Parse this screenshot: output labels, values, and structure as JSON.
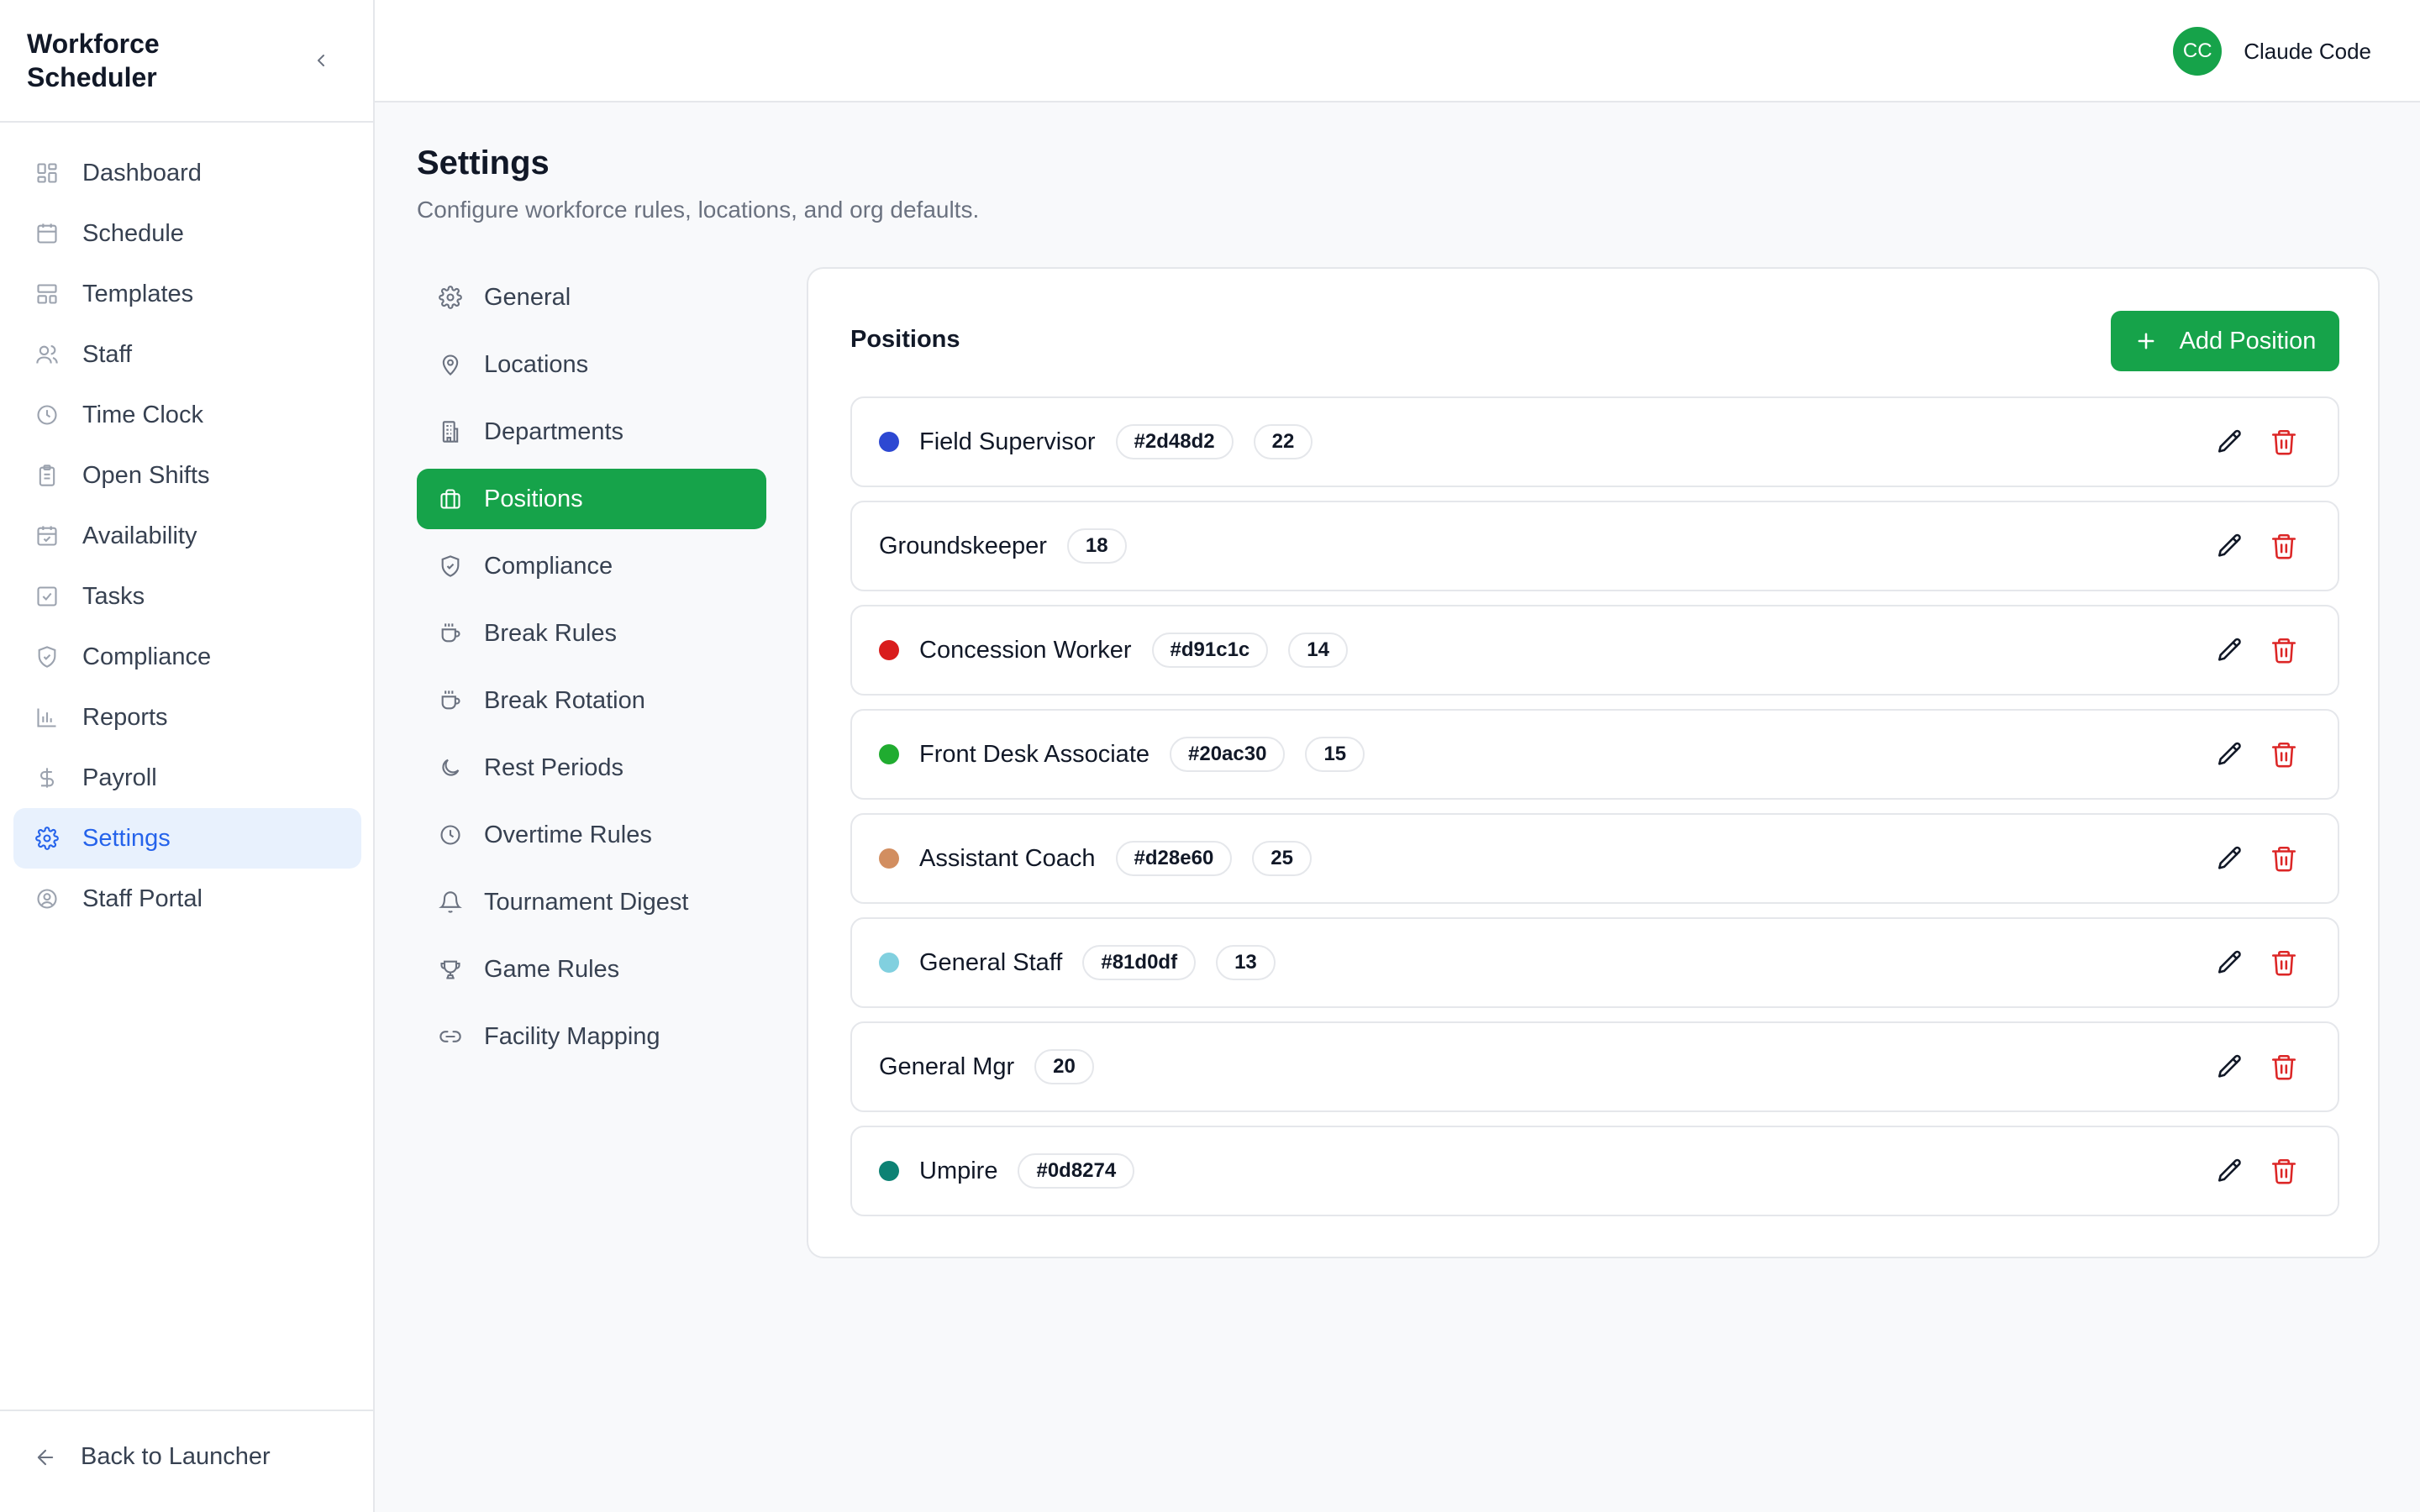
{
  "app": {
    "title": "Workforce Scheduler"
  },
  "sidebar": {
    "items": [
      {
        "label": "Dashboard",
        "icon": "grid-icon"
      },
      {
        "label": "Schedule",
        "icon": "calendar-icon"
      },
      {
        "label": "Templates",
        "icon": "layout-icon"
      },
      {
        "label": "Staff",
        "icon": "users-icon"
      },
      {
        "label": "Time Clock",
        "icon": "clock-icon"
      },
      {
        "label": "Open Shifts",
        "icon": "clipboard-icon"
      },
      {
        "label": "Availability",
        "icon": "calendar-check-icon"
      },
      {
        "label": "Tasks",
        "icon": "checkbox-icon"
      },
      {
        "label": "Compliance",
        "icon": "shield-icon"
      },
      {
        "label": "Reports",
        "icon": "bar-chart-icon"
      },
      {
        "label": "Payroll",
        "icon": "dollar-icon"
      },
      {
        "label": "Settings",
        "icon": "gear-icon",
        "active": true
      },
      {
        "label": "Staff Portal",
        "icon": "user-circle-icon"
      }
    ],
    "footer": {
      "label": "Back to Launcher"
    }
  },
  "topbar": {
    "user": {
      "initials": "CC",
      "name": "Claude Code",
      "avatar_color": "#16a34a"
    }
  },
  "main": {
    "title": "Settings",
    "subtitle": "Configure workforce rules, locations, and org defaults."
  },
  "settings_nav": {
    "items": [
      {
        "label": "General",
        "icon": "gear-icon"
      },
      {
        "label": "Locations",
        "icon": "map-pin-icon"
      },
      {
        "label": "Departments",
        "icon": "building-icon"
      },
      {
        "label": "Positions",
        "icon": "briefcase-icon",
        "active": true
      },
      {
        "label": "Compliance",
        "icon": "shield-icon"
      },
      {
        "label": "Break Rules",
        "icon": "coffee-icon"
      },
      {
        "label": "Break Rotation",
        "icon": "coffee-icon"
      },
      {
        "label": "Rest Periods",
        "icon": "moon-icon"
      },
      {
        "label": "Overtime Rules",
        "icon": "clock-icon"
      },
      {
        "label": "Tournament Digest",
        "icon": "bell-icon"
      },
      {
        "label": "Game Rules",
        "icon": "trophy-icon"
      },
      {
        "label": "Facility Mapping",
        "icon": "link-icon"
      }
    ]
  },
  "positions": {
    "title": "Positions",
    "add_label": "Add Position",
    "accent": "#16a34a",
    "rows": [
      {
        "name": "Field Supervisor",
        "color": "#2d48d2",
        "color_label": "#2d48d2",
        "count": "22"
      },
      {
        "name": "Groundskeeper",
        "color": null,
        "color_label": null,
        "count": "18"
      },
      {
        "name": "Concession Worker",
        "color": "#d91c1c",
        "color_label": "#d91c1c",
        "count": "14"
      },
      {
        "name": "Front Desk Associate",
        "color": "#20ac30",
        "color_label": "#20ac30",
        "count": "15"
      },
      {
        "name": "Assistant Coach",
        "color": "#d28e60",
        "color_label": "#d28e60",
        "count": "25"
      },
      {
        "name": "General Staff",
        "color": "#81d0df",
        "color_label": "#81d0df",
        "count": "13"
      },
      {
        "name": "General Mgr",
        "color": null,
        "color_label": null,
        "count": "20"
      },
      {
        "name": "Umpire",
        "color": "#0d8274",
        "color_label": "#0d8274",
        "count": null
      }
    ]
  }
}
